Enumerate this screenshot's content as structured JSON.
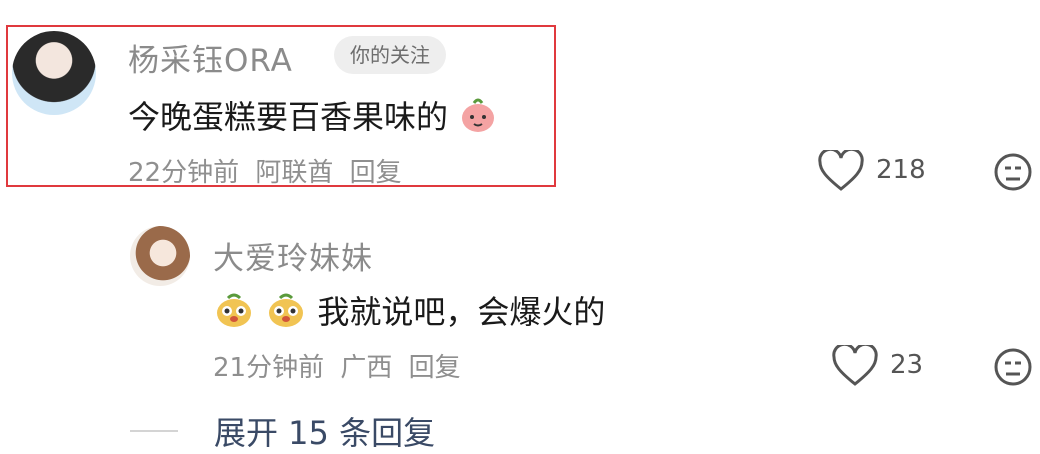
{
  "comments": [
    {
      "username": "杨采钰ORA",
      "tag": "你的关注",
      "text": "今晚蛋糕要百香果味的",
      "time": "22分钟前",
      "location": "阿联酋",
      "reply": "回复",
      "likes": "218"
    },
    {
      "username": "大爱玲妹妹",
      "text": "我就说吧，会爆火的",
      "time": "21分钟前",
      "location": "广西",
      "reply": "回复",
      "likes": "23"
    }
  ],
  "expand_replies": "展开 15 条回复"
}
